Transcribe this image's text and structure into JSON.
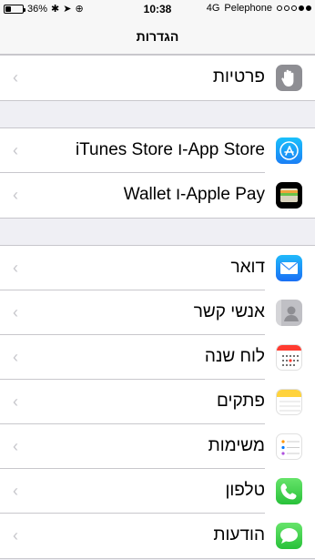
{
  "status_bar": {
    "battery": "36%",
    "battery_level": 0.36,
    "time": "10:38",
    "network": "4G",
    "carrier": "Pelephone",
    "signal_bars_filled": 2,
    "signal_bars_total": 5
  },
  "nav": {
    "title": "הגדרות"
  },
  "groups": [
    {
      "rows": [
        {
          "label": "פרטיות",
          "icon": "hand-icon"
        }
      ]
    },
    {
      "rows": [
        {
          "label": "App Store-ו iTunes Store",
          "icon": "app-store-icon"
        },
        {
          "label": "Apple Pay-ו Wallet",
          "icon": "wallet-icon"
        }
      ]
    },
    {
      "rows": [
        {
          "label": "דואר",
          "icon": "mail-icon"
        },
        {
          "label": "אנשי קשר",
          "icon": "contacts-icon"
        },
        {
          "label": "לוח שנה",
          "icon": "calendar-icon"
        },
        {
          "label": "פתקים",
          "icon": "notes-icon"
        },
        {
          "label": "משימות",
          "icon": "reminders-icon"
        },
        {
          "label": "טלפון",
          "icon": "phone-icon"
        },
        {
          "label": "הודעות",
          "icon": "messages-icon"
        }
      ]
    }
  ],
  "colors": {
    "background": "#efeff4",
    "separator": "#c8c7cc",
    "chevron": "#c7c7cc"
  }
}
